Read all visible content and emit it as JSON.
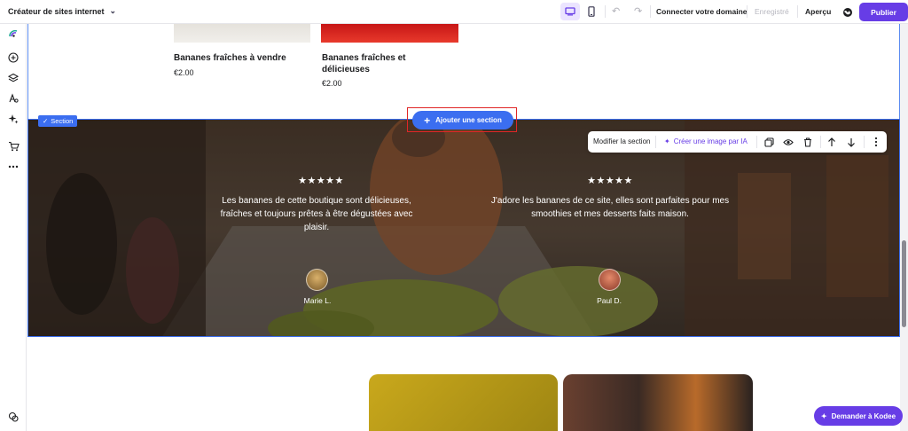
{
  "topbar": {
    "builder_label": "Créateur de sites internet",
    "connect_domain": "Connecter votre domaine",
    "saved": "Enregistré",
    "preview": "Aperçu",
    "publish": "Publier"
  },
  "products": [
    {
      "name": "Bananes fraîches à vendre",
      "price": "€2.00"
    },
    {
      "name": "Bananes fraîches et délicieuses",
      "price": "€2.00"
    }
  ],
  "section_badge": "Section",
  "add_section": "Ajouter une section",
  "section_toolbar": {
    "edit": "Modifier la section",
    "ai_image": "Créer une image par IA"
  },
  "testimonials": [
    {
      "stars": "★★★★★",
      "text": "Les bananes de cette boutique sont délicieuses, fraîches et toujours prêtes à être dégustées avec plaisir.",
      "author": "Marie L."
    },
    {
      "stars": "★★★★★",
      "text": "J'adore les bananes de ce site, elles sont parfaites pour mes smoothies et mes desserts faits maison.",
      "author": "Paul D."
    }
  ],
  "kodee": "Demander à Kodee",
  "colors": {
    "accent": "#673de6",
    "selection": "#3b6ef0",
    "highlight": "#e02626"
  }
}
